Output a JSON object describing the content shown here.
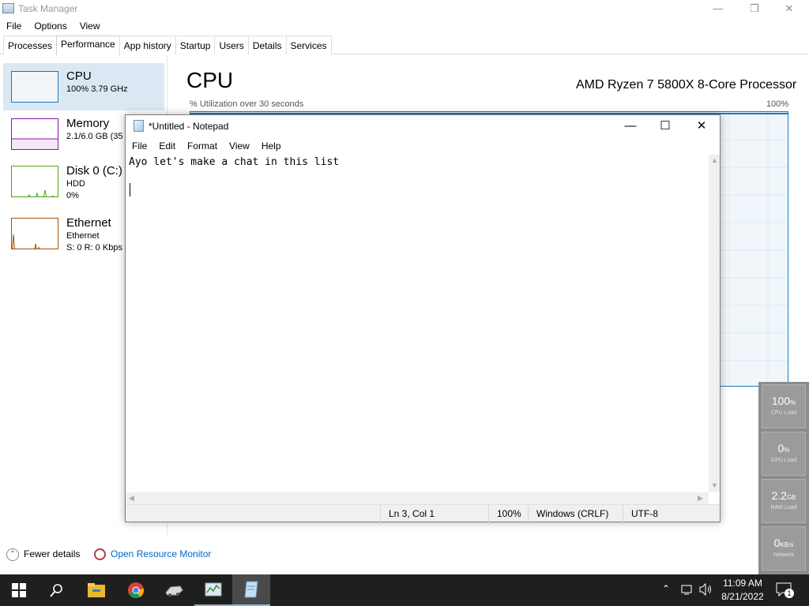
{
  "task_manager": {
    "title": "Task Manager",
    "menu": [
      "File",
      "Options",
      "View"
    ],
    "tabs": [
      "Processes",
      "Performance",
      "App history",
      "Startup",
      "Users",
      "Details",
      "Services"
    ],
    "active_tab": "Performance",
    "sidebar": [
      {
        "name": "CPU",
        "sub1": "100% 3.79 GHz",
        "sub2": ""
      },
      {
        "name": "Memory",
        "sub1": "2.1/6.0 GB (35",
        "sub2": ""
      },
      {
        "name": "Disk 0 (C:)",
        "sub1": "HDD",
        "sub2": "0%"
      },
      {
        "name": "Ethernet",
        "sub1": "Ethernet",
        "sub2": "S: 0 R: 0 Kbps"
      }
    ],
    "main_title": "CPU",
    "processor": "AMD Ryzen 7 5800X 8-Core Processor",
    "util_label": "% Utilization over 30 seconds",
    "util_max": "100%",
    "fewer_details": "Fewer details",
    "open_resource_monitor": "Open Resource Monitor"
  },
  "gadget": [
    {
      "value": "100",
      "unit": "%",
      "label": "CPU Load"
    },
    {
      "value": "0",
      "unit": "%",
      "label": "GPU Load"
    },
    {
      "value": "2.2",
      "unit": "GB",
      "label": "RAM Load"
    },
    {
      "value": "0",
      "unit": "KB/s",
      "label": "Network"
    }
  ],
  "notepad": {
    "title": "*Untitled - Notepad",
    "menu": [
      "File",
      "Edit",
      "Format",
      "View",
      "Help"
    ],
    "lines": [
      "Ayo let's make a chat in this list",
      "",
      ""
    ],
    "status": {
      "position": "Ln 3, Col 1",
      "zoom": "100%",
      "line_ending": "Windows (CRLF)",
      "encoding": "UTF-8"
    }
  },
  "taskbar": {
    "time": "11:09 AM",
    "date": "8/21/2022",
    "notification_count": "1",
    "apps": [
      "start-icon",
      "search-icon",
      "file-explorer-icon",
      "chrome-icon",
      "app-icon",
      "task-manager-icon",
      "notepad-icon"
    ]
  },
  "colors": {
    "cpu_accent": "#117dbb",
    "memory_accent": "#8b12ae",
    "disk_accent": "#4da60c",
    "ethernet_accent": "#a74f01",
    "taskbar": "#1f1f1f"
  }
}
